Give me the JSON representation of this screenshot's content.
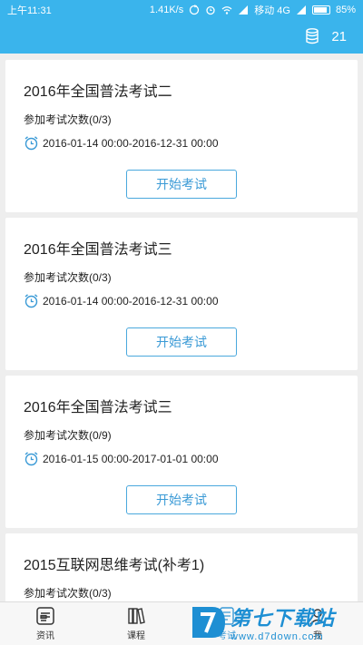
{
  "status_bar": {
    "time": "上午11:31",
    "speed": "1.41K/s",
    "carrier": "移动 4G",
    "battery": "85%"
  },
  "header": {
    "coin_count": "21"
  },
  "exams": [
    {
      "title": "2016年全国普法考试二",
      "attempts": "参加考试次数(0/3)",
      "period": "2016-01-14 00:00-2016-12-31 00:00",
      "button": "开始考试"
    },
    {
      "title": "2016年全国普法考试三",
      "attempts": "参加考试次数(0/3)",
      "period": "2016-01-14 00:00-2016-12-31 00:00",
      "button": "开始考试"
    },
    {
      "title": "2016年全国普法考试三",
      "attempts": "参加考试次数(0/9)",
      "period": "2016-01-15 00:00-2017-01-01 00:00",
      "button": "开始考试"
    },
    {
      "title": "2015互联网思维考试(补考1)",
      "attempts": "参加考试次数(0/3)"
    }
  ],
  "tabs": [
    {
      "label": "资讯",
      "icon": "news-icon"
    },
    {
      "label": "课程",
      "icon": "books-icon"
    },
    {
      "label": "考试",
      "icon": "exam-icon"
    },
    {
      "label": "我",
      "icon": "profile-icon"
    }
  ],
  "watermark": {
    "title": "第七下载站",
    "url": "www.d7down.com"
  },
  "colors": {
    "primary": "#3ab4ec",
    "button_border": "#4aa8dd",
    "button_text": "#3a9ad6",
    "background": "#eeeeee"
  }
}
